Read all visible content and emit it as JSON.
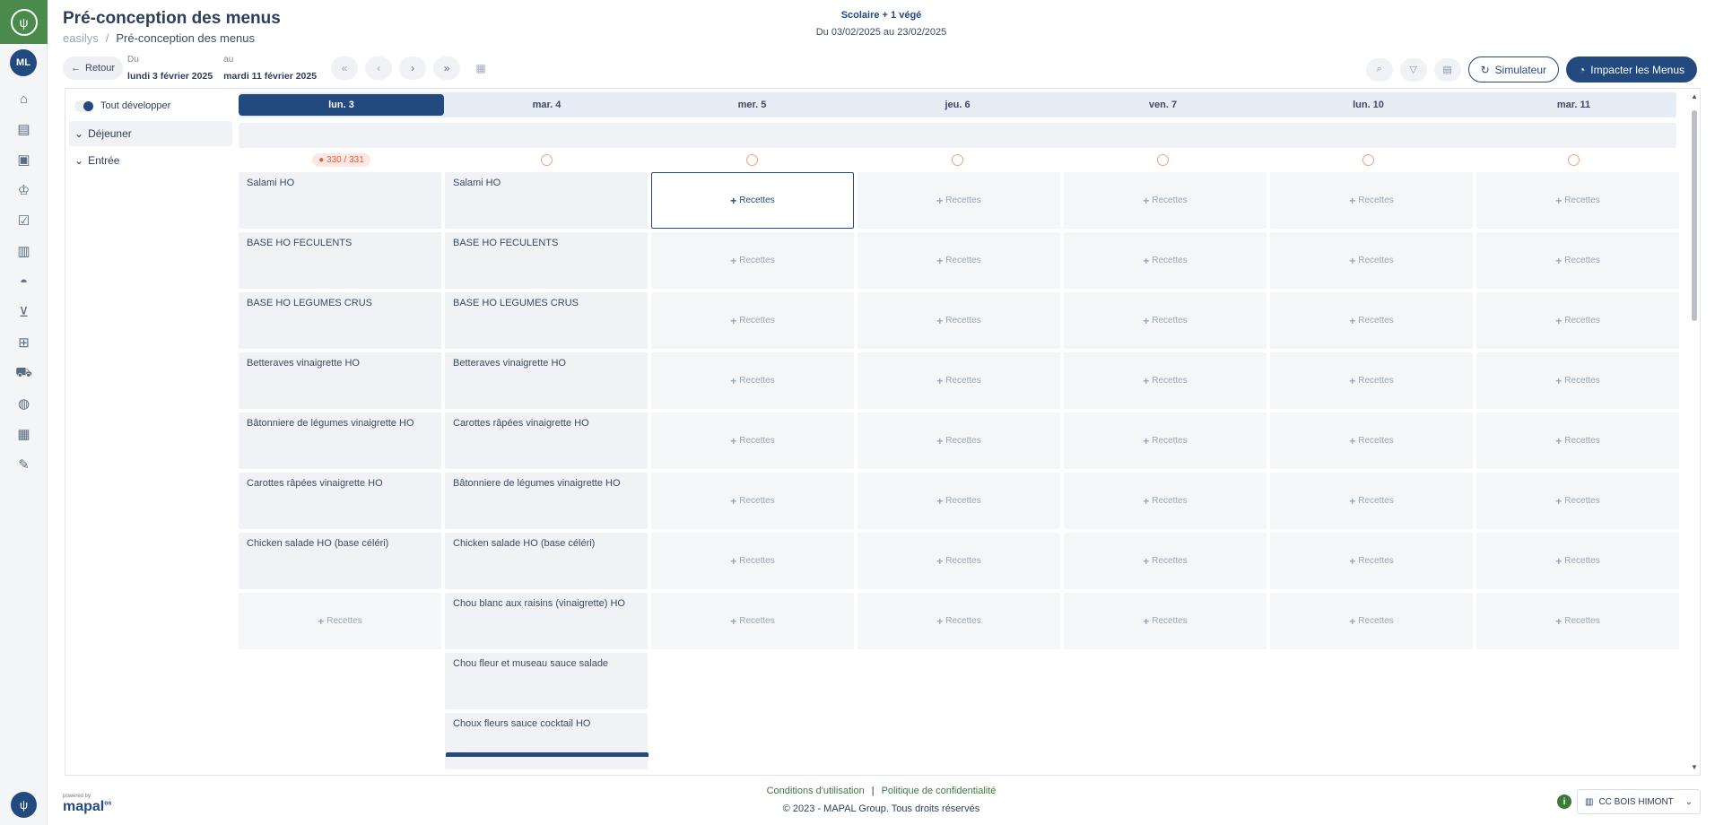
{
  "sidebar": {
    "avatar_initials": "ML",
    "nav_icons": [
      "home-icon",
      "store-icon",
      "box-icon",
      "chef-hat-icon",
      "checklist-icon",
      "report-icon",
      "cloche-icon",
      "cart-icon",
      "production-icon",
      "truck-icon",
      "globe-icon",
      "calendar-icon",
      "wrench-icon"
    ]
  },
  "header": {
    "title": "Pré-conception des menus",
    "breadcrumb_root": "easilys",
    "breadcrumb_sep": "/",
    "breadcrumb_current": "Pré-conception des menus"
  },
  "center": {
    "title": "Scolaire + 1 végé",
    "range": "Du 03/02/2025 au 23/02/2025"
  },
  "toolbar": {
    "back_label": "Retour",
    "from_label": "Du",
    "from_value": "lundi 3 février 2025",
    "to_label": "au",
    "to_value": "mardi 11 février 2025",
    "simulator_label": "Simulateur",
    "impact_label": "Impacter les Menus"
  },
  "left": {
    "toggle_label": "Tout développer",
    "group_label": "Déjeuner",
    "sub_label": "Entrée"
  },
  "days": [
    "lun. 3",
    "mar. 4",
    "mer. 5",
    "jeu. 6",
    "ven. 7",
    "lun. 10",
    "mar. 11"
  ],
  "active_day_index": 0,
  "count_badge": "330 / 331",
  "add_label": "Recettes",
  "grid": {
    "col0": [
      "Salami HO",
      "BASE HO FECULENTS",
      "BASE HO LEGUMES CRUS",
      "Betteraves vinaigrette HO",
      "Bâtonniere de légumes vinaigrette HO",
      "Carottes râpées vinaigrette HO",
      "Chicken salade HO (base céléri)"
    ],
    "col1": [
      "Salami HO",
      "BASE HO FECULENTS",
      "BASE HO LEGUMES CRUS",
      "Betteraves vinaigrette HO",
      "Carottes râpées vinaigrette HO",
      "Bâtonniere de légumes vinaigrette HO",
      "Chicken salade HO (base céléri)",
      "Chou blanc aux raisins (vinaigrette) HO",
      "Chou fleur et museau sauce salade",
      "Choux fleurs sauce cocktail HO"
    ]
  },
  "footer": {
    "powered_by": "powered by",
    "brand": "mapal",
    "brand_suffix": "os",
    "terms": "Conditions d'utilisation",
    "separator": "|",
    "privacy": "Politique de confidentialité",
    "copyright": "© 2023 - MAPAL Group. Tous droits réservés",
    "site": "CC BOIS HIMONT"
  },
  "colors": {
    "primary": "#234a7e",
    "brand_green": "#4a8a4a",
    "alert": "#e0603d"
  }
}
